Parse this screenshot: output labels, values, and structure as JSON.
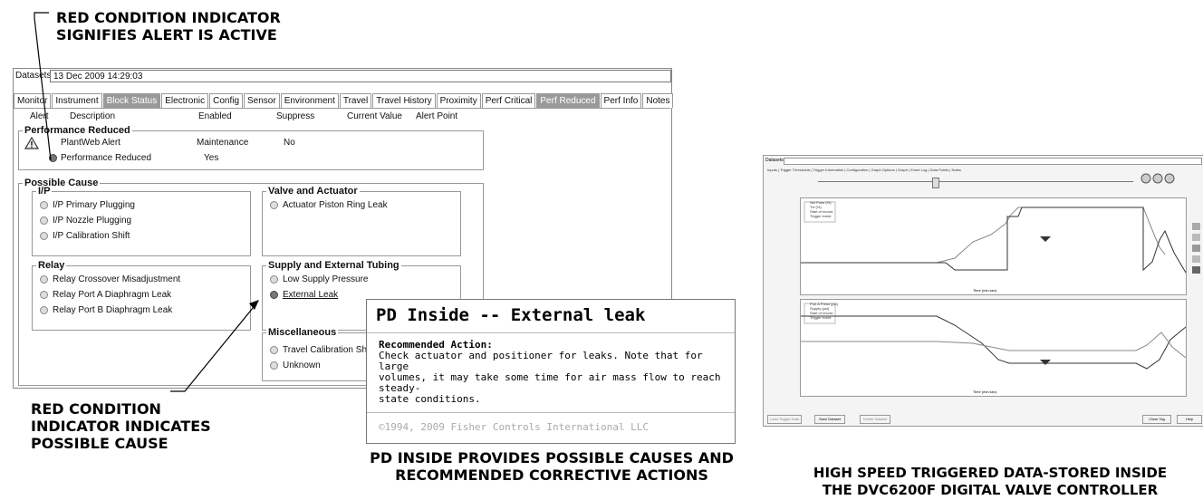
{
  "callouts": {
    "top": [
      "RED CONDITION INDICATOR",
      "SIGNIFIES ALERT IS ACTIVE"
    ],
    "bottom_left": [
      "RED CONDITION",
      "INDICATOR INDICATES",
      "POSSIBLE CAUSE"
    ],
    "bottom_center": [
      "PD INSIDE PROVIDES POSSIBLE CAUSES AND",
      "RECOMMENDED CORRECTIVE ACTIONS"
    ],
    "bottom_right": [
      "HIGH SPEED TRIGGERED DATA-STORED INSIDE",
      "THE DVC6200f DIGITAL VALVE CONTROLLER"
    ]
  },
  "window": {
    "datasets_label": "Datasets:",
    "datasets_value": "13 Dec 2009 14:29:03",
    "tabs": [
      "Monitor",
      "Instrument",
      "Block Status",
      "Electronic",
      "Config",
      "Sensor",
      "Environment",
      "Travel",
      "Travel History",
      "Proximity",
      "Perf Critical",
      "Perf Reduced",
      "Perf Info",
      "Notes"
    ],
    "highlighted_tabs": [
      "Block Status",
      "Perf Reduced"
    ],
    "columns": [
      "Alert",
      "Description",
      "Enabled",
      "Suppress",
      "Current Value",
      "Alert Point"
    ],
    "perf_group_title": "Performance Reduced",
    "plantweb_alert": "PlantWeb Alert",
    "plantweb_enabled": "Maintenance",
    "plantweb_suppress": "No",
    "perf_reduced": "Performance Reduced",
    "perf_reduced_enabled": "Yes",
    "possible_cause_title": "Possible Cause",
    "ip": {
      "title": "I/P",
      "items": [
        "I/P Primary Plugging",
        "I/P Nozzle Plugging",
        "I/P Calibration Shift"
      ]
    },
    "relay": {
      "title": "Relay",
      "items": [
        "Relay Crossover Misadjustment",
        "Relay Port A Diaphragm Leak",
        "Relay Port B Diaphragm Leak"
      ]
    },
    "valve": {
      "title": "Valve and Actuator",
      "items": [
        "Actuator Piston Ring Leak"
      ]
    },
    "supply": {
      "title": "Supply and External Tubing",
      "items": [
        "Low Supply Pressure",
        "External Leak"
      ]
    },
    "misc": {
      "title": "Miscellaneous",
      "items": [
        "Travel Calibration Shift",
        "Unknown"
      ]
    }
  },
  "popup": {
    "title": "PD Inside -- External leak",
    "action_label": "Recommended Action:",
    "action_text": [
      "Check actuator and positioner for leaks. Note that for large",
      "volumes, it may take some time for air mass flow to reach steady-",
      "state conditions."
    ],
    "footer": "©1994, 2009 Fisher Controls International LLC"
  },
  "trend": {
    "tabs": "Inputs | Trigger Thresholds | Trigger Information | Configuration | Graph Options | Graph | Event Log | Data Points | Notes",
    "legend1": [
      "Set Point (%)",
      "Tvl (%)",
      "Start of record",
      "Trigger event"
    ],
    "legend2": [
      "Port A Press (psi)",
      "Supply (psi)",
      "Start of record",
      "Trigger event"
    ],
    "xlabel": "Time (min:sec)",
    "buttons": [
      "Load Trigger Data",
      "Save Dataset",
      "Delete Dataset",
      "Close Tag",
      "Help"
    ]
  }
}
